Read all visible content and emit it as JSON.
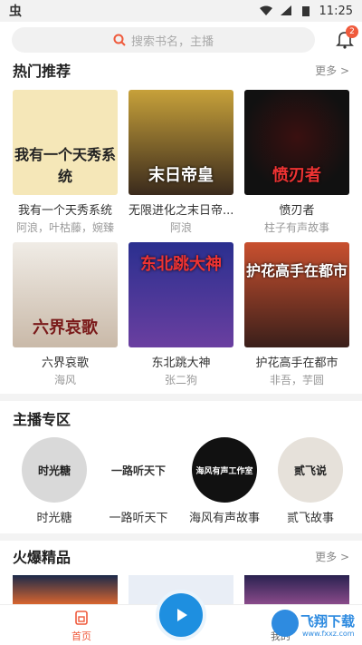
{
  "status": {
    "time": "11:25"
  },
  "search": {
    "placeholder": "搜索书名，主播"
  },
  "notifications": {
    "count": "2"
  },
  "hot": {
    "title": "热门推荐",
    "more": "更多 >",
    "items": [
      {
        "title": "我有一个天秀系统",
        "author": "阿浪，叶枯藤，婉臻",
        "cover_text": "我有一个天秀系统",
        "bg": "#f5e7b8"
      },
      {
        "title": "无限进化之末日帝...",
        "author": "阿浪",
        "cover_text": "末日帝皇",
        "bg": "#6b5a2e"
      },
      {
        "title": "愤刃者",
        "author": "柱子有声故事",
        "cover_text": "愤刃者",
        "bg": "#1c1c1c"
      },
      {
        "title": "六界哀歌",
        "author": "海风",
        "cover_text": "六界哀歌",
        "bg": "#e8e2dc"
      },
      {
        "title": "东北跳大神",
        "author": "张二狗",
        "cover_text": "东北跳大神",
        "bg": "#3a3fb5"
      },
      {
        "title": "护花高手在都市",
        "author": "非吾，芋圆",
        "cover_text": "护花高手在都市",
        "bg": "#9a3b2a"
      }
    ]
  },
  "anchors": {
    "title": "主播专区",
    "items": [
      {
        "name": "时光糖",
        "logo": "时光糖",
        "bg": "#d9d9d9",
        "fg": "#222"
      },
      {
        "name": "一路听天下",
        "logo": "一路听天下",
        "bg": "#ffffff",
        "fg": "#333"
      },
      {
        "name": "海风有声故事",
        "logo": "海风有声工作室",
        "bg": "#111111",
        "fg": "#fff"
      },
      {
        "name": "贰飞故事",
        "logo": "贰飞说",
        "bg": "#e6e1da",
        "fg": "#222"
      }
    ]
  },
  "hotpicks": {
    "title": "火爆精品",
    "more": "更多 >"
  },
  "nav": {
    "home": "首页",
    "mine": "我的"
  },
  "watermark": {
    "text": "飞翔下载",
    "url": "www.fxxz.com"
  }
}
